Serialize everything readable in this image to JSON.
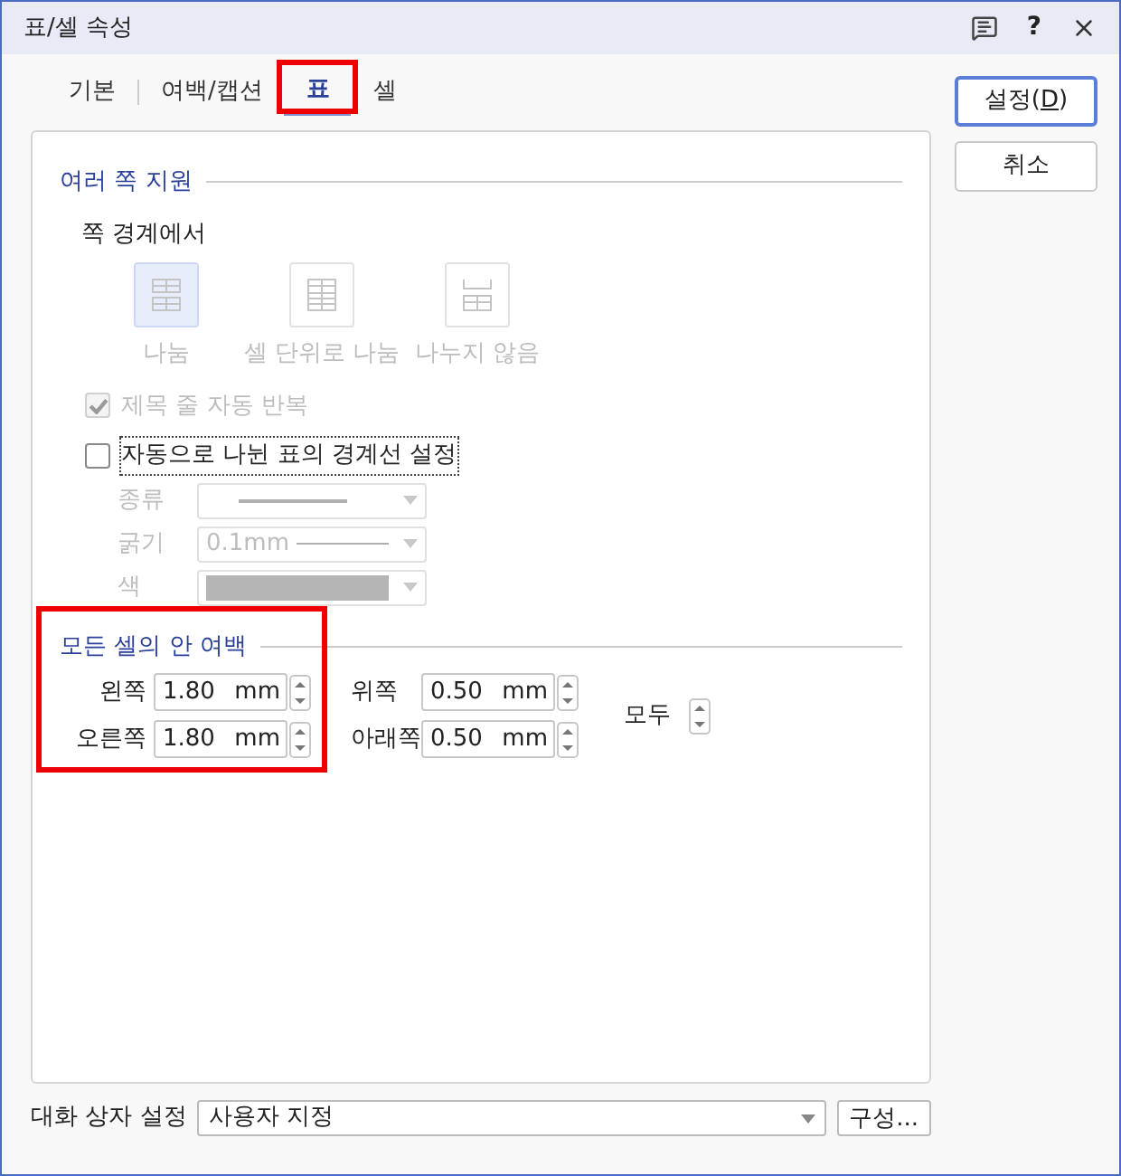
{
  "window": {
    "title": "표/셀 속성",
    "help": "?"
  },
  "tabs": [
    {
      "label": "기본",
      "selected": false,
      "highlighted": false
    },
    {
      "label": "여백/캡션",
      "selected": false,
      "highlighted": false
    },
    {
      "label": "표",
      "selected": true,
      "highlighted": true
    },
    {
      "label": "셀",
      "selected": false,
      "highlighted": false
    }
  ],
  "buttons": [
    {
      "label": "설정(",
      "accel": "D",
      "suffix": ")",
      "default": true
    },
    {
      "label": "취소",
      "default": false
    }
  ],
  "multi_page": {
    "title": "여러 쪽 지원",
    "subtitle": "쪽 경계에서",
    "split_options": [
      {
        "label": "나눔",
        "kind": "split",
        "selected": true,
        "disabled": true
      },
      {
        "label": "셀 단위로 나눔",
        "kind": "cell",
        "selected": false,
        "disabled": true
      },
      {
        "label": "나누지 않음",
        "kind": "none",
        "selected": false,
        "disabled": true
      }
    ],
    "repeat_header": {
      "label": "제목 줄 자동 반복",
      "checked": true,
      "disabled": true
    },
    "auto_border": {
      "label": "자동으로 나뉜 표의 경계선 설정",
      "checked": false,
      "disabled": false,
      "focused": true
    },
    "border_fields": [
      {
        "label": "종류",
        "kind": "line",
        "disabled": true
      },
      {
        "label": "굵기",
        "kind": "thickness",
        "value": "0.1mm",
        "disabled": true
      },
      {
        "label": "색",
        "kind": "color",
        "color": "#b4b4b4",
        "disabled": true
      }
    ]
  },
  "inner_margin": {
    "title": "모든 셀의 안 여백",
    "highlighted": true,
    "fields": [
      {
        "label": "왼쪽",
        "value": "1.80",
        "unit": "mm"
      },
      {
        "label": "위쪽",
        "value": "0.50",
        "unit": "mm"
      },
      {
        "label": "오른쪽",
        "value": "1.80",
        "unit": "mm"
      },
      {
        "label": "아래쪽",
        "value": "0.50",
        "unit": "mm"
      }
    ],
    "all_label": "모두"
  },
  "footer": {
    "label": "대화 상자 설정",
    "value": "사용자 지정",
    "button": "구성..."
  }
}
